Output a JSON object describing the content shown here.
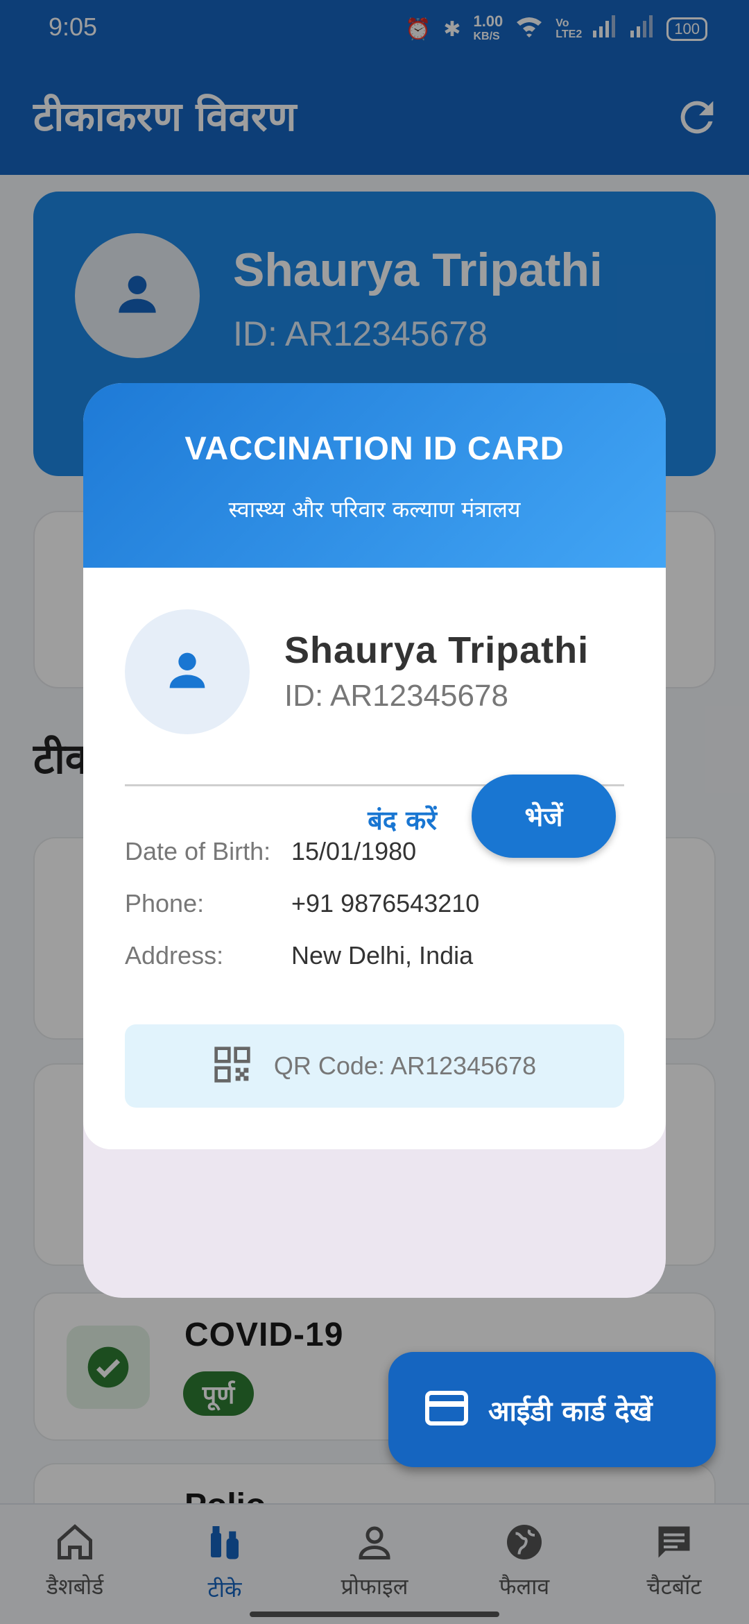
{
  "status_bar": {
    "time": "9:05",
    "speed_value": "1.00",
    "speed_unit": "KB/S",
    "volte": "Vo LTE2",
    "battery": "100"
  },
  "app_bar": {
    "title": "टीकाकरण विवरण",
    "refresh_icon": "refresh-icon"
  },
  "profile_header": {
    "name": "Shaurya Tripathi",
    "id": "ID: AR12345678"
  },
  "section": {
    "title": "टीकाकरण"
  },
  "vaccines": [
    {
      "name": "COVID-19",
      "status": "पूर्ण",
      "status_color": "#2e7d32"
    },
    {
      "name": "Polio"
    }
  ],
  "fab": {
    "label": "आईडी कार्ड देखें",
    "icon": "card-icon"
  },
  "bottom_nav": [
    {
      "label": "डैशबोर्ड",
      "icon": "home-icon"
    },
    {
      "label": "टीके",
      "icon": "vaccine-icon",
      "active": true
    },
    {
      "label": "प्रोफाइल",
      "icon": "person-icon"
    },
    {
      "label": "फैलाव",
      "icon": "globe-icon"
    },
    {
      "label": "चैटबॉट",
      "icon": "chat-icon"
    }
  ],
  "dialog": {
    "title": "VACCINATION ID CARD",
    "subtitle": "स्वास्थ्य और परिवार कल्याण मंत्रालय",
    "name": "Shaurya Tripathi",
    "id": "ID: AR12345678",
    "fields": [
      {
        "label": "Date of Birth:",
        "value": "15/01/1980"
      },
      {
        "label": "Phone:",
        "value": "+91 9876543210"
      },
      {
        "label": "Address:",
        "value": "New Delhi, India"
      }
    ],
    "qr_label": "QR Code: AR12345678",
    "close_label": "बंद करें",
    "send_label": "भेजें"
  },
  "colors": {
    "primary": "#1565c0",
    "accent": "#1976d2",
    "success": "#2e7d32"
  }
}
